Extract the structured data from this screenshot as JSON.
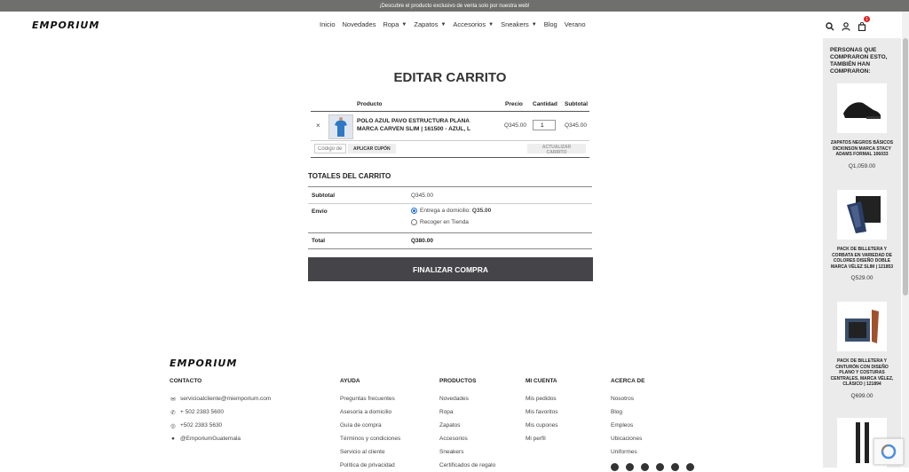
{
  "topbar": {
    "text": "¡Descubre el producto exclusivo de venta solo por nuestra web!"
  },
  "header": {
    "logo": "EMPORIUM",
    "nav": [
      {
        "label": "Inicio",
        "dropdown": false
      },
      {
        "label": "Novedades",
        "dropdown": false
      },
      {
        "label": "Ropa",
        "dropdown": true
      },
      {
        "label": "Zapatos",
        "dropdown": true
      },
      {
        "label": "Accesorios",
        "dropdown": true
      },
      {
        "label": "Sneakers",
        "dropdown": true
      },
      {
        "label": "Blog",
        "dropdown": false
      },
      {
        "label": "Verano",
        "dropdown": false
      }
    ],
    "cart_count": "1"
  },
  "cart": {
    "title": "EDITAR CARRITO",
    "headers": {
      "product": "Producto",
      "price": "Precio",
      "qty": "Cantidad",
      "subtotal": "Subtotal"
    },
    "item": {
      "name": "POLO AZUL PAVO ESTRUCTURA PLANA MARCA CARVEN SLIM | 161500 - AZUL, L",
      "price": "Q345.00",
      "qty": "1",
      "subtotal": "Q345.00",
      "remove": "×"
    },
    "coupon_placeholder": "Código de cupón",
    "apply_coupon": "APLICAR CUPÓN",
    "update_cart": "ACTUALIZAR CARRITO"
  },
  "totals": {
    "title": "TOTALES DEL CARRITO",
    "subtotal_label": "Subtotal",
    "subtotal_value": "Q345.00",
    "shipping_label": "Envío",
    "shipping_option1": "Entrega a domicilio:",
    "shipping_option1_price": "Q35.00",
    "shipping_option2": "Recoger en Tienda",
    "total_label": "Total",
    "total_value": "Q380.00",
    "checkout": "FINALIZAR COMPRA"
  },
  "sidebar": {
    "title": "PERSONAS QUE COMPRARON ESTO, TAMBIÉN HAN COMPRARON:",
    "items": [
      {
        "name": "ZAPATOS NEGROS BÁSICOS DICKINSON MARCA STACY ADAMS FORMAL 106033",
        "price": "Q1,059.00"
      },
      {
        "name": "PACK DE BILLETERA Y CORBATA EN VARIEDAD DE COLORES DISEÑO DOBLE MARCA VÉLEZ SLIM | 121853",
        "price": "Q529.00"
      },
      {
        "name": "PACK DE BILLETERA Y CINTURÓN CON DISEÑO PLANO Y COSTURAS CENTRALES, MARCA VÉLEZ, CLÁSICO | 121894",
        "price": "Q699.00"
      }
    ]
  },
  "footer": {
    "logo": "EMPORIUM",
    "contacto": {
      "title": "CONTACTO",
      "email": "servicioalcliente@miemporium.com",
      "phone1": "+ 502 2383 5600",
      "phone2": "+502 2383 5630",
      "messenger": "@EmporiumGuatemala"
    },
    "ayuda": {
      "title": "AYUDA",
      "items": [
        "Preguntas frecuentes",
        "Asesoría a domicilio",
        "Guía de compra",
        "Términos y condiciones",
        "Servicio al cliente",
        "Política de privacidad"
      ]
    },
    "productos": {
      "title": "PRODUCTOS",
      "items": [
        "Novedades",
        "Ropa",
        "Zapatos",
        "Accesorios",
        "Sneakers",
        "Certificados de regalo"
      ]
    },
    "micuenta": {
      "title": "MI CUENTA",
      "items": [
        "Mis pedidos",
        "Mis favoritos",
        "Mis cupones",
        "Mi perfil"
      ]
    },
    "acercade": {
      "title": "ACERCA DE",
      "items": [
        "Nosotros",
        "Blog",
        "Empleos",
        "Ubicaciones",
        "Uniformes"
      ]
    }
  }
}
